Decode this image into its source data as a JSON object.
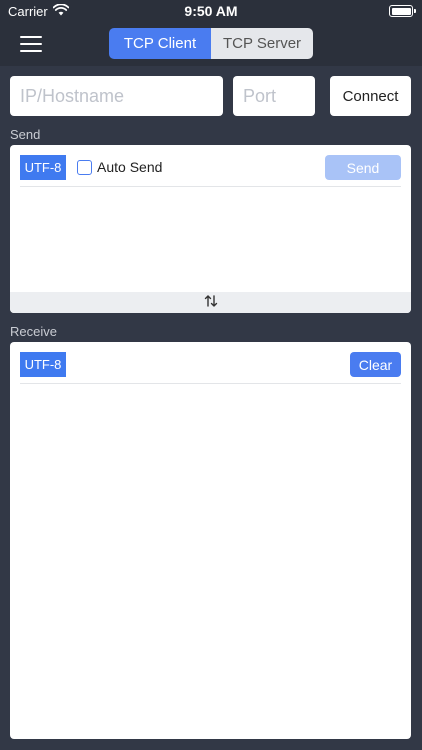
{
  "status": {
    "carrier": "Carrier",
    "time": "9:50 AM"
  },
  "nav": {
    "tabs": [
      {
        "label": "TCP Client",
        "active": true
      },
      {
        "label": "TCP Server",
        "active": false
      }
    ],
    "menu_icon": "hamburger-menu-icon"
  },
  "connection": {
    "ip_placeholder": "IP/Hostname",
    "port_placeholder": "Port",
    "connect_label": "Connect"
  },
  "send": {
    "section_label": "Send",
    "encoding": "UTF-8",
    "auto_send_label": "Auto Send",
    "auto_send_checked": false,
    "send_label": "Send",
    "swap_icon": "swap-arrows-icon"
  },
  "receive": {
    "section_label": "Receive",
    "encoding": "UTF-8",
    "clear_label": "Clear"
  },
  "colors": {
    "accent": "#4a7cf0",
    "disabled_accent": "#a9c3f7",
    "background": "#2b303b"
  }
}
